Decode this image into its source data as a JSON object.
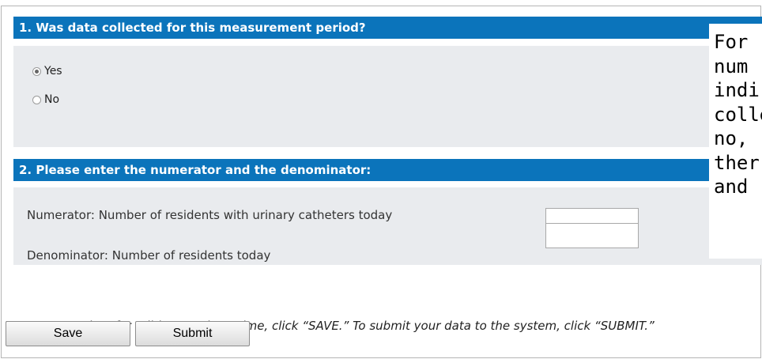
{
  "question1": {
    "header": "1. Was data collected for this measurement period?",
    "options": [
      {
        "label": "Yes",
        "selected": true
      },
      {
        "label": "No",
        "selected": false
      }
    ]
  },
  "question2": {
    "header": "2. Please enter the numerator and the denominator:",
    "numerator_label": "Numerator: Number of residents with urinary catheters today",
    "numerator_value": "",
    "denominator_label": "Denominator: Number of residents today",
    "denominator_value": ""
  },
  "help_text": "To save your data for editing at a later time, click “SAVE.” To submit your data to the system, click “SUBMIT.”",
  "buttons": {
    "save": "Save",
    "submit": "Submit"
  },
  "tooltip": {
    "lines": [
      "For",
      "num",
      "indi",
      "colle",
      "no,",
      "ther",
      "and"
    ]
  },
  "colors": {
    "header_bg": "#0b74bb",
    "section_bg": "#e9ebee"
  }
}
